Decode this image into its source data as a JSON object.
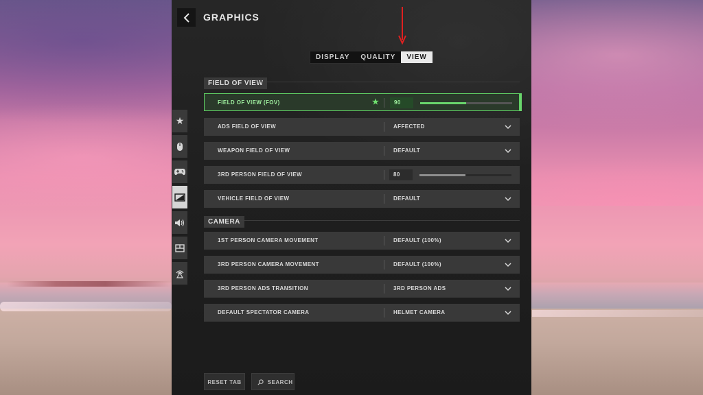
{
  "page": {
    "title": "GRAPHICS"
  },
  "tabs": [
    {
      "label": "DISPLAY"
    },
    {
      "label": "QUALITY"
    },
    {
      "label": "VIEW",
      "active": true
    }
  ],
  "sections": {
    "fov": {
      "title": "FIELD OF VIEW"
    },
    "camera": {
      "title": "CAMERA"
    }
  },
  "rows": {
    "fov": {
      "label": "FIELD OF VIEW (FOV)",
      "value": "90",
      "slider_fraction": 0.5,
      "favorite_icon": "star-icon"
    },
    "ads_fov": {
      "label": "ADS FIELD OF VIEW",
      "value": "AFFECTED"
    },
    "weapon_fov": {
      "label": "WEAPON FIELD OF VIEW",
      "value": "DEFAULT"
    },
    "third_person_fov": {
      "label": "3RD PERSON FIELD OF VIEW",
      "value": "80",
      "slider_fraction": 0.5
    },
    "vehicle_fov": {
      "label": "VEHICLE FIELD OF VIEW",
      "value": "DEFAULT"
    },
    "first_person_cam": {
      "label": "1ST PERSON CAMERA MOVEMENT",
      "value": "DEFAULT (100%)"
    },
    "third_person_cam": {
      "label": "3RD PERSON CAMERA MOVEMENT",
      "value": "DEFAULT (100%)"
    },
    "third_person_ads": {
      "label": "3RD PERSON ADS TRANSITION",
      "value": "3RD PERSON ADS"
    },
    "spectator_cam": {
      "label": "DEFAULT SPECTATOR CAMERA",
      "value": "HELMET CAMERA"
    }
  },
  "footer": {
    "reset_label": "RESET TAB",
    "search_label": "SEARCH"
  },
  "colors": {
    "accent_green": "#69d56c",
    "annotation_arrow": "#e02020",
    "panel_bg": "#222222"
  },
  "sidebar_icons": [
    "star-icon",
    "mouse-icon",
    "controller-icon",
    "graphics-icon",
    "speaker-icon",
    "interface-icon",
    "network-icon"
  ]
}
